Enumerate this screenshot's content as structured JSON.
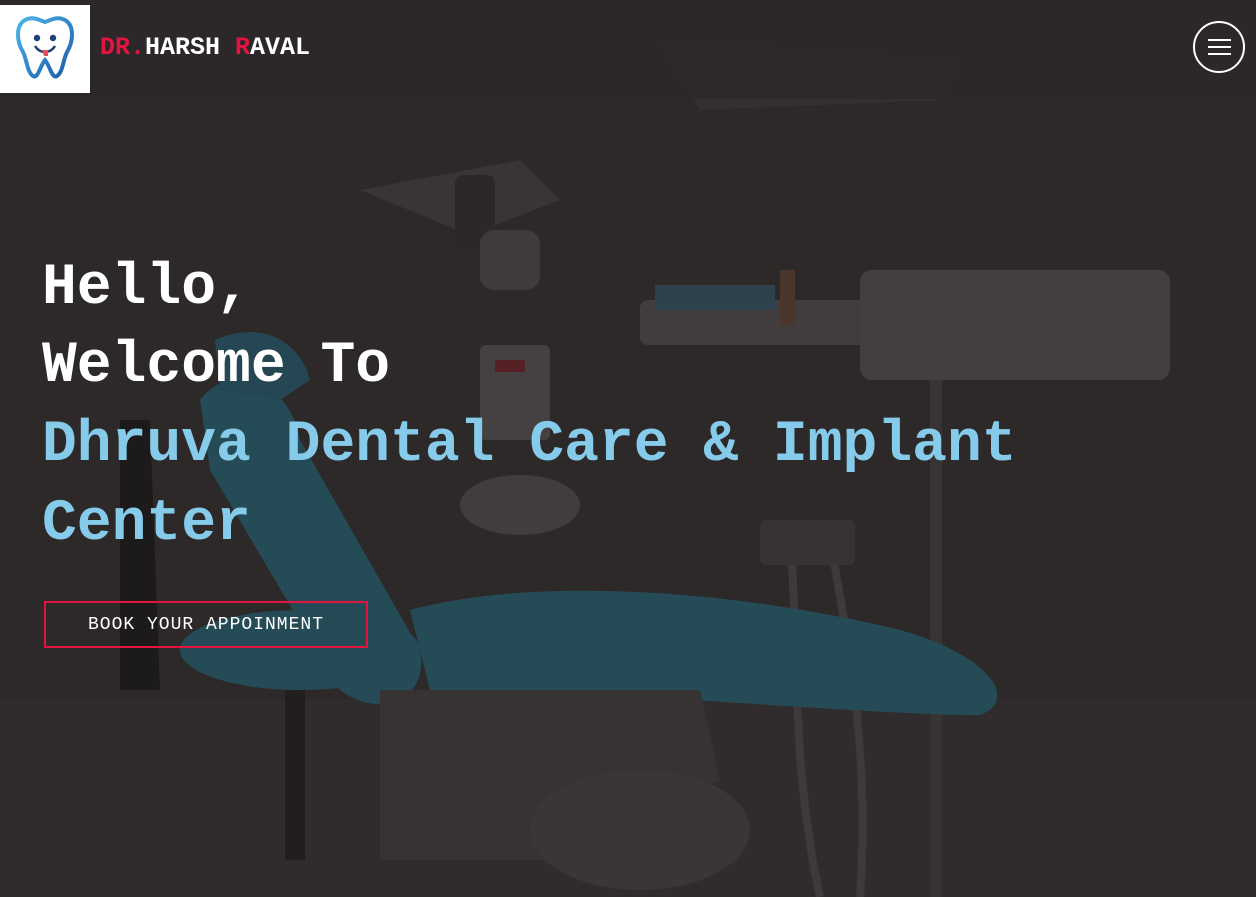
{
  "header": {
    "logo_icon": "tooth-mascot-icon",
    "brand": {
      "part1_red": "DR.",
      "part2": "HARSH ",
      "part3_red": "R",
      "part4": "AVAL"
    },
    "menu_icon": "hamburger-menu-icon"
  },
  "hero": {
    "line1": "Hello,",
    "line2": "Welcome To",
    "line3": "Dhruva Dental Care & Implant",
    "line4": "Center",
    "cta_label": "BOOK YOUR APPOINMENT"
  },
  "colors": {
    "accent_red": "#e3153f",
    "accent_blue": "#86cbea",
    "header_bg": "#2b2829",
    "text": "#ffffff"
  },
  "background_image": "dental-chair-clinic-photo"
}
